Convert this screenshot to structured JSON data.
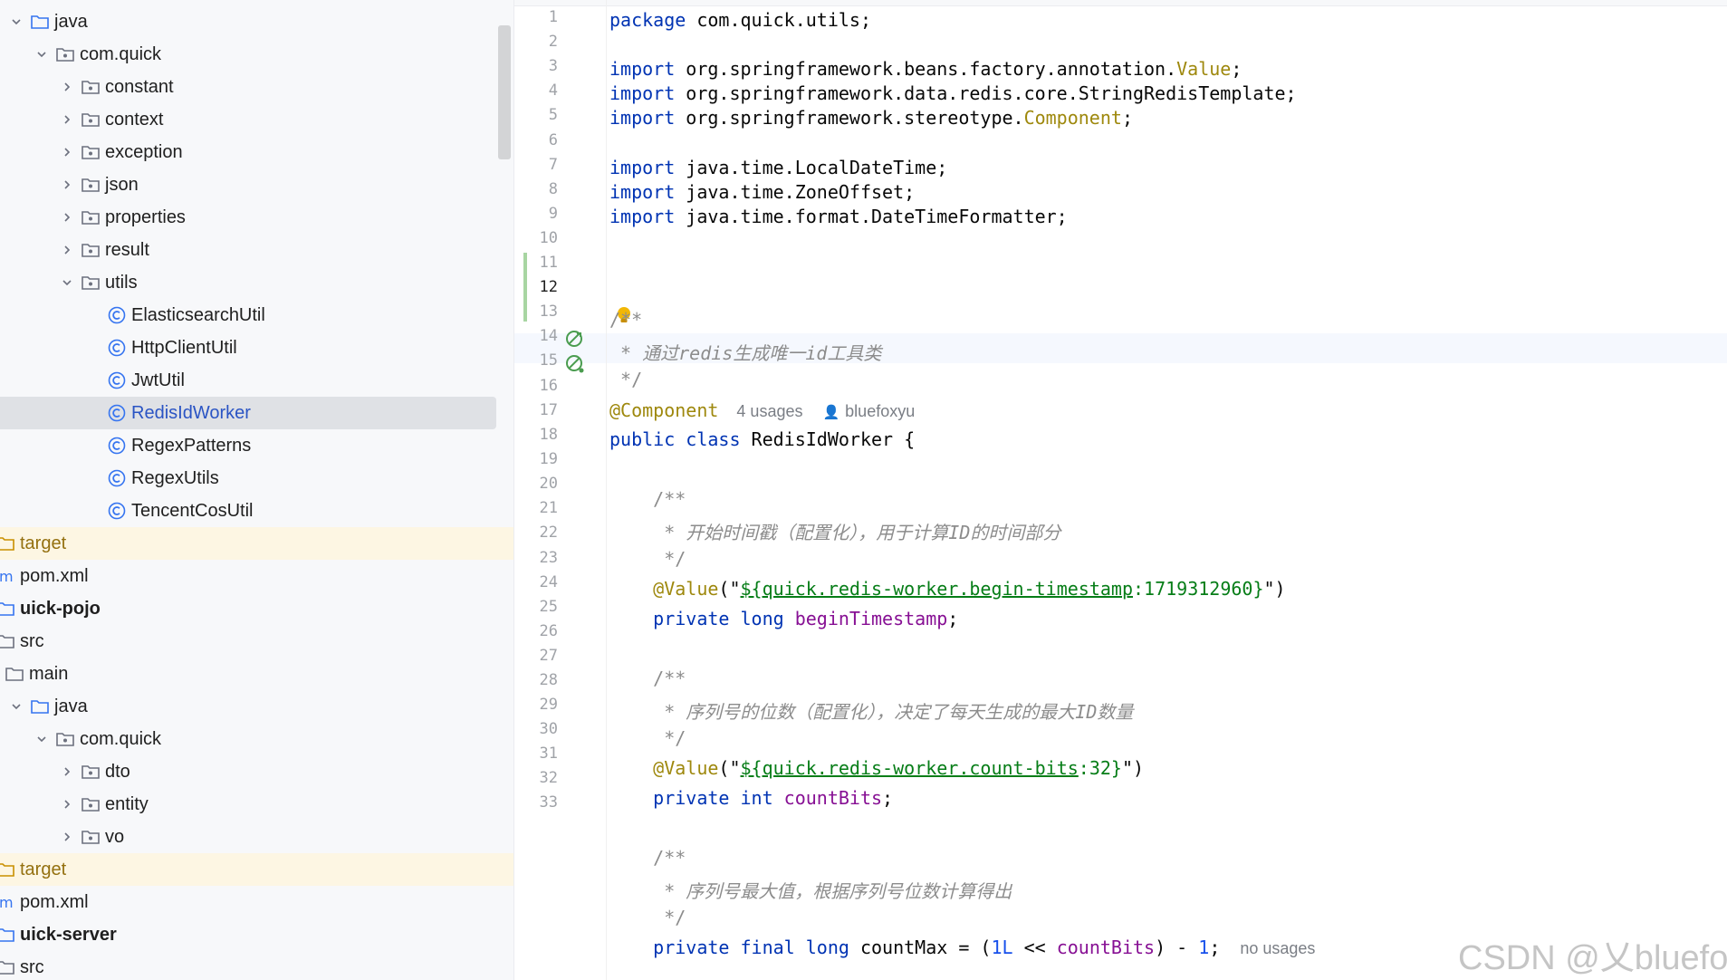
{
  "project_tree": [
    {
      "label": "java",
      "icon": "source-folder-icon",
      "chevron": "down"
    },
    {
      "label": "com.quick",
      "icon": "package-icon",
      "chevron": "down"
    },
    {
      "label": "constant",
      "icon": "package-icon",
      "chevron": "right"
    },
    {
      "label": "context",
      "icon": "package-icon",
      "chevron": "right"
    },
    {
      "label": "exception",
      "icon": "package-icon",
      "chevron": "right"
    },
    {
      "label": "json",
      "icon": "package-icon",
      "chevron": "right"
    },
    {
      "label": "properties",
      "icon": "package-icon",
      "chevron": "right"
    },
    {
      "label": "result",
      "icon": "package-icon",
      "chevron": "right"
    },
    {
      "label": "utils",
      "icon": "package-icon",
      "chevron": "down"
    },
    {
      "label": "ElasticsearchUtil",
      "icon": "class-icon"
    },
    {
      "label": "HttpClientUtil",
      "icon": "class-icon"
    },
    {
      "label": "JwtUtil",
      "icon": "class-icon"
    },
    {
      "label": "RedisIdWorker",
      "icon": "class-icon",
      "selected": true
    },
    {
      "label": "RegexPatterns",
      "icon": "class-icon"
    },
    {
      "label": "RegexUtils",
      "icon": "class-icon"
    },
    {
      "label": "TencentCosUtil",
      "icon": "class-icon"
    },
    {
      "label": "target",
      "icon": "excluded-folder-icon"
    },
    {
      "label": "pom.xml",
      "icon": "maven-file-icon"
    },
    {
      "label": "uick-pojo",
      "icon": "module-icon"
    },
    {
      "label": "src",
      "icon": "folder-icon"
    },
    {
      "label": "main",
      "icon": "folder-icon"
    },
    {
      "label": "java",
      "icon": "source-folder-icon",
      "chevron": "down"
    },
    {
      "label": "com.quick",
      "icon": "package-icon",
      "chevron": "down"
    },
    {
      "label": "dto",
      "icon": "package-icon",
      "chevron": "right"
    },
    {
      "label": "entity",
      "icon": "package-icon",
      "chevron": "right"
    },
    {
      "label": "vo",
      "icon": "package-icon",
      "chevron": "right"
    },
    {
      "label": "target",
      "icon": "excluded-folder-icon"
    },
    {
      "label": "pom.xml",
      "icon": "maven-file-icon"
    },
    {
      "label": "uick-server",
      "icon": "module-icon"
    },
    {
      "label": "src",
      "icon": "folder-icon"
    }
  ],
  "editor": {
    "line_numbers": [
      "1",
      "2",
      "3",
      "4",
      "5",
      "6",
      "7",
      "8",
      "9",
      "10",
      "11",
      "12",
      "13",
      "14",
      "15",
      "16",
      "17",
      "18",
      "19",
      "20",
      "21",
      "22",
      "23",
      "24",
      "25",
      "26",
      "27",
      "28",
      "29",
      "30",
      "31",
      "32",
      "33"
    ],
    "current_line": "12",
    "code": {
      "l1_kw": "package",
      "l1_rest": " com.quick.utils;",
      "import_kw": "import",
      "l3_rest": " org.springframework.beans.factory.annotation.",
      "l3_name": "Value",
      "l4_rest": " org.springframework.data.redis.core.StringRedisTemplate;",
      "l5_rest": " org.springframework.stereotype.",
      "l5_name": "Component",
      "l7_rest": " java.time.LocalDateTime;",
      "l8_rest": " java.time.ZoneOffset;",
      "l9_rest": " java.time.format.DateTimeFormatter;",
      "l11": "/**",
      "l12": " * 通过redis生成唯一id工具类",
      "l13": " */",
      "l14_ann": "@Component",
      "l14_usages": "4 usages",
      "l14_author": "bluefoxyu",
      "l15_kw": "public class",
      "l15_rest": " RedisIdWorker {",
      "l17": "    /**",
      "l18": "     * 开始时间戳（配置化），用于计算ID的时间部分",
      "l19": "     */",
      "l20_ann": "    @Value",
      "l20_open": "(\"",
      "l20_prop": "${quick.redis-worker.begin-timestamp",
      "l20_default": ":1719312960}",
      "l20_close": "\")",
      "l21_kw": "    private long",
      "l21_field": " beginTimestamp",
      "l21_end": ";",
      "l23": "    /**",
      "l24": "     * 序列号的位数（配置化），决定了每天生成的最大ID数量",
      "l25": "     */",
      "l26_ann": "    @Value",
      "l26_open": "(\"",
      "l26_prop": "${quick.redis-worker.count-bits",
      "l26_default": ":32}",
      "l26_close": "\")",
      "l27_kw": "    private int",
      "l27_field": " countBits",
      "l27_end": ";",
      "l29": "    /**",
      "l30": "     * 序列号最大值，根据序列号位数计算得出",
      "l31": "     */",
      "l32_kw": "    private final long",
      "l32_name": " countMax = (",
      "l32_num1": "1L",
      "l32_op": " << ",
      "l32_field": "countBits",
      "l32_mid": ") - ",
      "l32_num2": "1",
      "l32_end": ";",
      "l32_hint": "no usages"
    }
  },
  "watermark": "CSDN @乂bluefox",
  "colors": {
    "keyword": "#0033b3",
    "annotation": "#9e880d",
    "comment": "#8c8c8c",
    "string": "#067d17",
    "field": "#871094",
    "number": "#1750eb",
    "selection": "#dfe1e5",
    "excluded_bg": "#fdf6e3"
  }
}
